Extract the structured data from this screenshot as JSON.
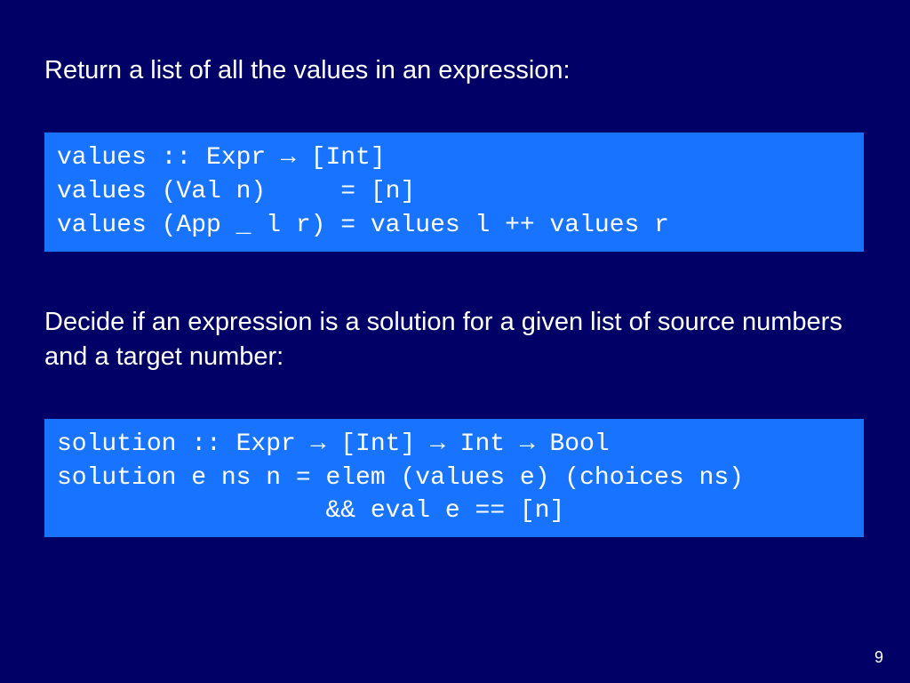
{
  "desc1": "Return a list of all the values in an expression:",
  "code1": "values :: Expr → [Int]\nvalues (Val n)     = [n]\nvalues (App _ l r) = values l ++ values r",
  "desc2": "Decide if an expression is a solution for a given list of source numbers and a target number:",
  "code2": "solution :: Expr → [Int] → Int → Bool\nsolution e ns n = elem (values e) (choices ns)\n                  && eval e == [n]",
  "page_number": "9"
}
